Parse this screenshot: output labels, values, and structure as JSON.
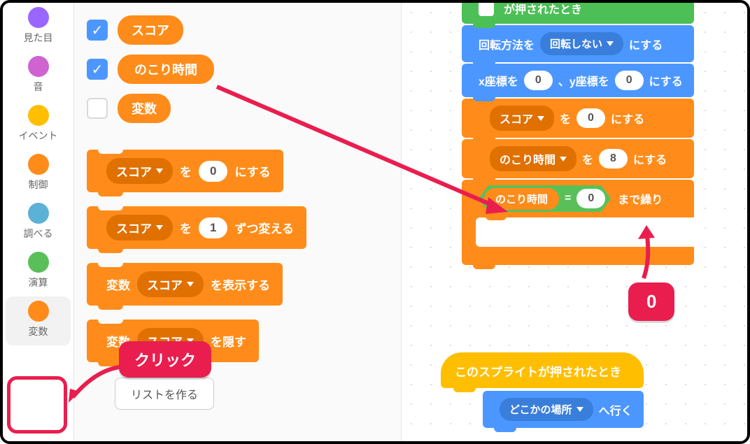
{
  "sidebar": {
    "categories": [
      {
        "label": "見た目",
        "color": "#9966ff"
      },
      {
        "label": "音",
        "color": "#cf63cf"
      },
      {
        "label": "イベント",
        "color": "#ffbf00"
      },
      {
        "label": "制御",
        "color": "#ff8c1a"
      },
      {
        "label": "調べる",
        "color": "#5cb1d6"
      },
      {
        "label": "演算",
        "color": "#59c059"
      },
      {
        "label": "変数",
        "color": "#ff8c1a"
      }
    ]
  },
  "palette": {
    "var1": "スコア",
    "var2": "のこり時間",
    "var3": "変数",
    "set_dd": "スコア",
    "set_to": "を",
    "set_val": "0",
    "set_suffix": "にする",
    "change_dd": "スコア",
    "change_to": "を",
    "change_val": "1",
    "change_suffix": "ずつ変える",
    "show_prefix": "変数",
    "show_dd": "スコア",
    "show_suffix": "を表示する",
    "hide_prefix": "変数",
    "hide_dd": "スコア",
    "hide_suffix": "を隠す",
    "make_list": "リストを作る"
  },
  "stack1": {
    "hat": "が押されたとき",
    "rot_prefix": "回転方法を",
    "rot_val": "回転しない",
    "rot_suffix": "にする",
    "goto_x": "x座標を",
    "x_val": "0",
    "goto_mid": "、y座標を",
    "y_val": "0",
    "goto_suffix": "にする",
    "set_score_dd": "スコア",
    "set_score_to": "を",
    "set_score_val": "0",
    "set_score_suffix": "にする",
    "set_time_dd": "のこり時間",
    "set_time_to": "を",
    "set_time_val": "8",
    "set_time_suffix": "にする",
    "until_var": "のこり時間",
    "until_eq": "=",
    "until_val": "0",
    "until_suffix": "まで繰り"
  },
  "stack2": {
    "hat": "このスプライトが押されたとき",
    "goto_dd": "どこかの場所",
    "goto_suffix": "へ行く"
  },
  "annotations": {
    "click": "クリック",
    "zero": "0"
  }
}
